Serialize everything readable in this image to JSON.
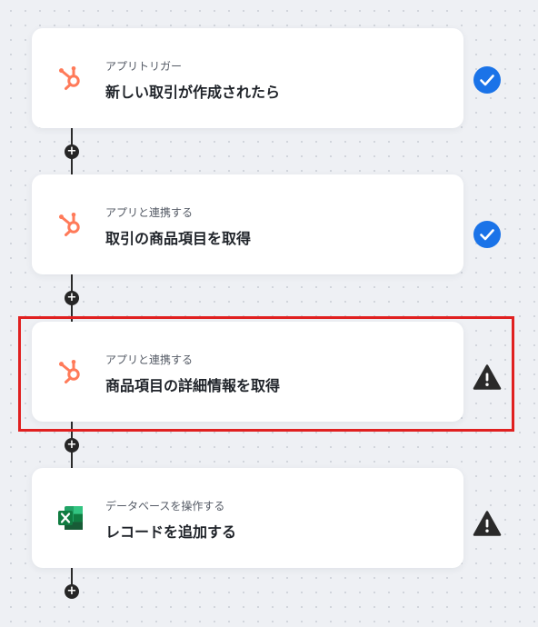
{
  "steps": [
    {
      "subtitle": "アプリトリガー",
      "title": "新しい取引が作成されたら",
      "app_icon": "hubspot-icon",
      "status": "check-circle-icon"
    },
    {
      "subtitle": "アプリと連携する",
      "title": "取引の商品項目を取得",
      "app_icon": "hubspot-icon",
      "status": "check-circle-icon"
    },
    {
      "subtitle": "アプリと連携する",
      "title": "商品項目の詳細情報を取得",
      "app_icon": "hubspot-icon",
      "status": "warning-icon"
    },
    {
      "subtitle": "データベースを操作する",
      "title": "レコードを追加する",
      "app_icon": "excel-icon",
      "status": "warning-icon"
    }
  ],
  "add_step_symbol": "+",
  "colors": {
    "hubspot": "#ff7a59",
    "check": "#1a73e8",
    "warning": "#2a2a2a",
    "highlight": "#e02020",
    "excel": "#107c41"
  }
}
